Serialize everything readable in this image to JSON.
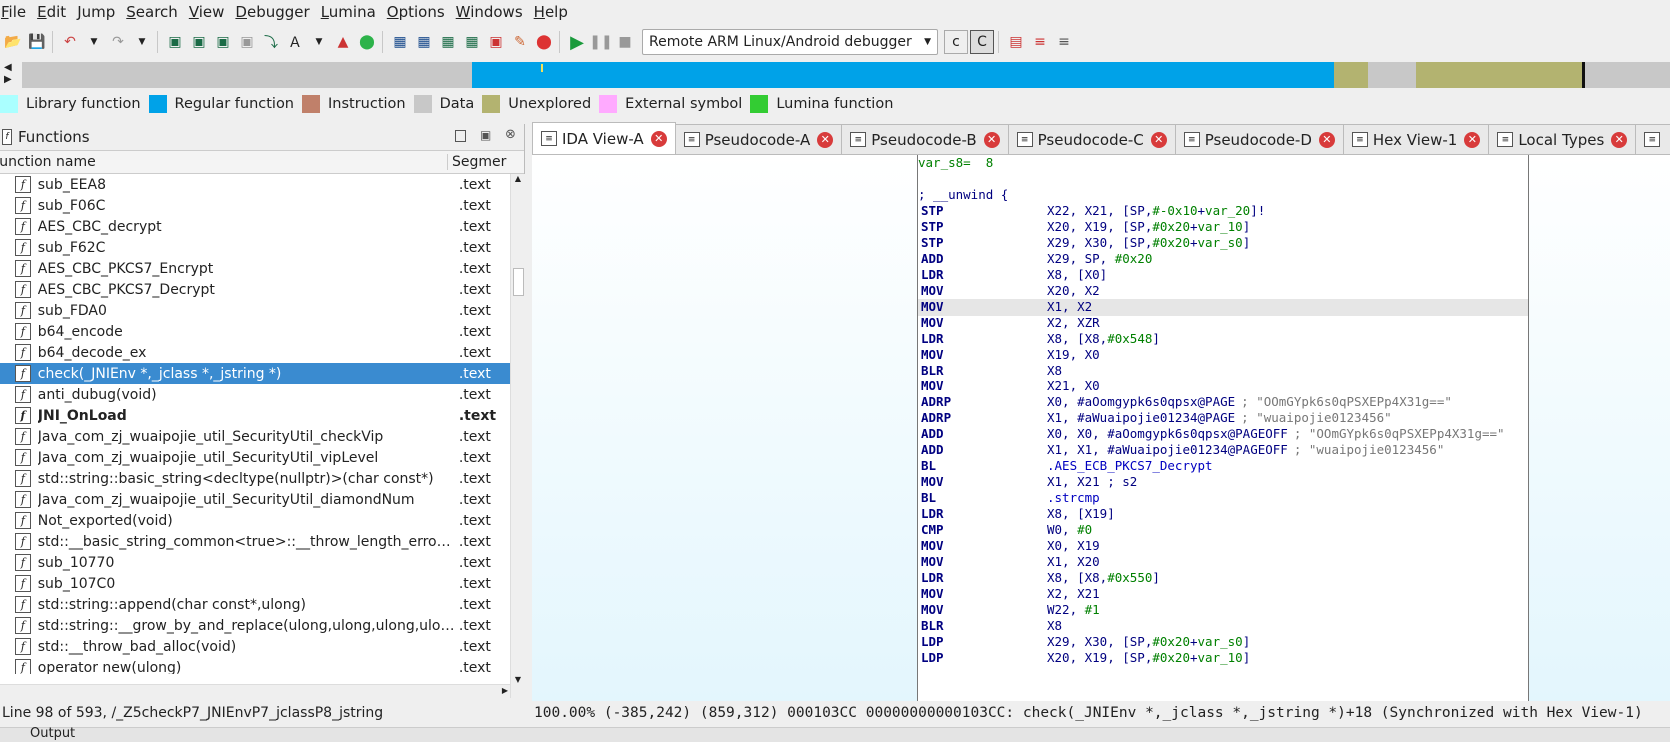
{
  "menu": [
    "File",
    "Edit",
    "Jump",
    "Search",
    "View",
    "Debugger",
    "Lumina",
    "Options",
    "Windows",
    "Help"
  ],
  "toolbar": {
    "debugger_select": "Remote ARM Linux/Android debugger"
  },
  "legend": [
    {
      "label": "Library function",
      "color": "#aaffff"
    },
    {
      "label": "Regular function",
      "color": "#00a2e8"
    },
    {
      "label": "Instruction",
      "color": "#c0806a"
    },
    {
      "label": "Data",
      "color": "#c8c8c8"
    },
    {
      "label": "Unexplored",
      "color": "#b3b370"
    },
    {
      "label": "External symbol",
      "color": "#ffaaff"
    },
    {
      "label": "Lumina function",
      "color": "#33cc33"
    }
  ],
  "functions_panel": {
    "title": "Functions",
    "col_name": "Function name",
    "col_segment": "Segmer",
    "rows": [
      {
        "name": "sub_EEA8",
        "seg": ".text"
      },
      {
        "name": "sub_F06C",
        "seg": ".text"
      },
      {
        "name": "AES_CBC_decrypt",
        "seg": ".text"
      },
      {
        "name": "sub_F62C",
        "seg": ".text"
      },
      {
        "name": "AES_CBC_PKCS7_Encrypt",
        "seg": ".text"
      },
      {
        "name": "AES_CBC_PKCS7_Decrypt",
        "seg": ".text"
      },
      {
        "name": "sub_FDA0",
        "seg": ".text"
      },
      {
        "name": "b64_encode",
        "seg": ".text"
      },
      {
        "name": "b64_decode_ex",
        "seg": ".text"
      },
      {
        "name": "check(_JNIEnv *,_jclass *,_jstring *)",
        "seg": ".text",
        "selected": true
      },
      {
        "name": "anti_dubug(void)",
        "seg": ".text"
      },
      {
        "name": "JNI_OnLoad",
        "seg": ".text",
        "bold": true
      },
      {
        "name": "Java_com_zj_wuaipojie_util_SecurityUtil_checkVip",
        "seg": ".text"
      },
      {
        "name": "Java_com_zj_wuaipojie_util_SecurityUtil_vipLevel",
        "seg": ".text"
      },
      {
        "name": "std::string::basic_string<decltype(nullptr)>(char const*)",
        "seg": ".text"
      },
      {
        "name": "Java_com_zj_wuaipojie_util_SecurityUtil_diamondNum",
        "seg": ".text"
      },
      {
        "name": "Not_exported(void)",
        "seg": ".text"
      },
      {
        "name": "std::__basic_string_common<true>::__throw_length_error(v...",
        "seg": ".text"
      },
      {
        "name": "sub_10770",
        "seg": ".text"
      },
      {
        "name": "sub_107C0",
        "seg": ".text"
      },
      {
        "name": "std::string::append(char const*,ulong)",
        "seg": ".text"
      },
      {
        "name": "std::string::__grow_by_and_replace(ulong,ulong,ulong,ulong...",
        "seg": ".text"
      },
      {
        "name": "std::__throw_bad_alloc(void)",
        "seg": ".text"
      },
      {
        "name": "operator new(ulong)",
        "seg": ".text"
      }
    ]
  },
  "tabs": [
    {
      "label": "IDA View-A",
      "icon": "ida-view-icon",
      "active": true
    },
    {
      "label": "Pseudocode-A",
      "icon": "pseudocode-icon"
    },
    {
      "label": "Pseudocode-B",
      "icon": "pseudocode-icon"
    },
    {
      "label": "Pseudocode-C",
      "icon": "pseudocode-icon"
    },
    {
      "label": "Pseudocode-D",
      "icon": "pseudocode-icon"
    },
    {
      "label": "Hex View-1",
      "icon": "hex-view-icon"
    },
    {
      "label": "Local Types",
      "icon": "local-types-icon"
    }
  ],
  "disasm": {
    "header_var": "var_s8=  8",
    "unwind": "; __unwind {",
    "lines": [
      {
        "m": "STP",
        "o": "X22, X21, [SP,#-0x10+var_20]!"
      },
      {
        "m": "STP",
        "o": "X20, X19, [SP,#0x20+var_10]"
      },
      {
        "m": "STP",
        "o": "X29, X30, [SP,#0x20+var_s0]"
      },
      {
        "m": "ADD",
        "o": "X29, SP, #0x20"
      },
      {
        "m": "LDR",
        "o": "X8, [X0]"
      },
      {
        "m": "MOV",
        "o": "X20, X2"
      },
      {
        "m": "MOV",
        "o": "X1, X2",
        "hl": true
      },
      {
        "m": "MOV",
        "o": "X2, XZR"
      },
      {
        "m": "LDR",
        "o": "X8, [X8,#0x548]"
      },
      {
        "m": "MOV",
        "o": "X19, X0"
      },
      {
        "m": "BLR",
        "o": "X8"
      },
      {
        "m": "MOV",
        "o": "X21, X0"
      },
      {
        "m": "ADRP",
        "o": "X0, #aOomgypk6s0qpsx@PAGE",
        "c": "; \"OOmGYpk6s0qPSXEPp4X31g==\""
      },
      {
        "m": "ADRP",
        "o": "X1, #aWuaipojie01234@PAGE",
        "c": "; \"wuaipojie0123456\""
      },
      {
        "m": "ADD",
        "o": "X0, X0, #aOomgypk6s0qpsx@PAGEOFF",
        "c": "; \"OOmGYpk6s0qPSXEPp4X31g==\""
      },
      {
        "m": "ADD",
        "o": "X1, X1, #aWuaipojie01234@PAGEOFF",
        "c": "; \"wuaipojie0123456\""
      },
      {
        "m": "BL",
        "o": ".AES_ECB_PKCS7_Decrypt",
        "lbl": true
      },
      {
        "m": "MOV",
        "o": "X1, X21 ; s2"
      },
      {
        "m": "BL",
        "o": ".strcmp",
        "lbl": true
      },
      {
        "m": "LDR",
        "o": "X8, [X19]"
      },
      {
        "m": "CMP",
        "o": "W0, #0"
      },
      {
        "m": "MOV",
        "o": "X0, X19"
      },
      {
        "m": "MOV",
        "o": "X1, X20"
      },
      {
        "m": "LDR",
        "o": "X8, [X8,#0x550]"
      },
      {
        "m": "MOV",
        "o": "X2, X21"
      },
      {
        "m": "MOV",
        "o": "W22, #1"
      },
      {
        "m": "BLR",
        "o": "X8"
      },
      {
        "m": "LDP",
        "o": "X29, X30, [SP,#0x20+var_s0]"
      },
      {
        "m": "LDP",
        "o": "X20, X19, [SP,#0x20+var_10]"
      }
    ]
  },
  "status": {
    "left": "Line 98 of 593, /_Z5checkP7_JNIEnvP7_jclassP8_jstring",
    "right": "100.00% (-385,242) (859,312) 000103CC 00000000000103CC: check(_JNIEnv *,_jclass *,_jstring *)+18 (Synchronized with Hex View-1)"
  },
  "bottom": {
    "label": "Output"
  }
}
